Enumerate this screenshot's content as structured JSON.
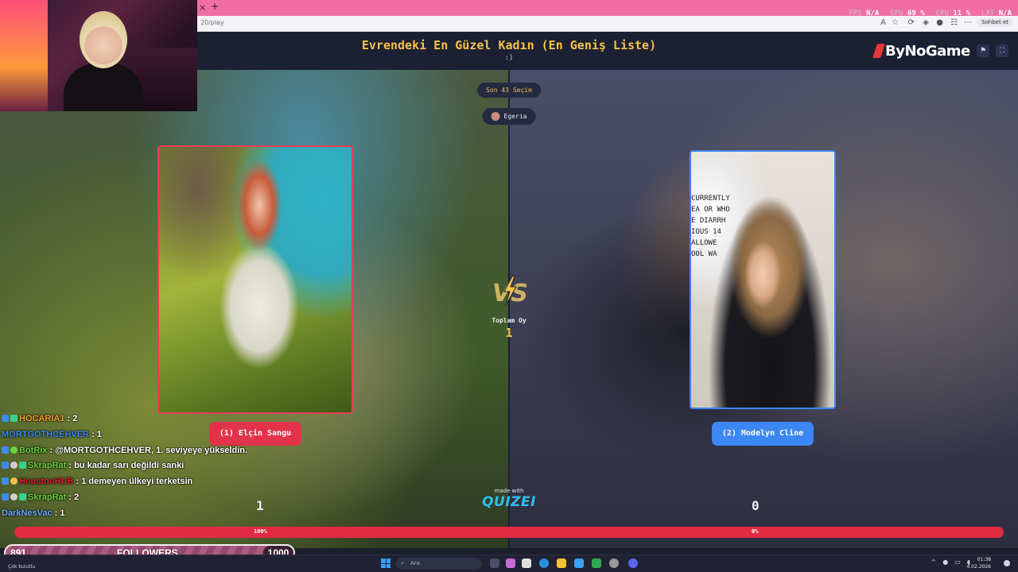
{
  "browser": {
    "url": "20/play",
    "chat_button": "Sohbet et"
  },
  "stats": {
    "fps_label": "FPS",
    "fps_value": "N/A",
    "gpu_label": "GPU",
    "gpu_value": "69 %",
    "cpu_label": "CPU",
    "cpu_value": "11 %",
    "lat_label": "LAT",
    "lat_value": "N/A"
  },
  "header": {
    "title": "Evrendeki En Güzel Kadın (En Geniş Liste)",
    "subtitle": ":)",
    "brand": "ByNoGame"
  },
  "game": {
    "recent_choices": "Son 43 Seçim",
    "user": "Egeria",
    "vs_label": "VS",
    "total_votes_label": "Toplam Oy",
    "total_votes": "1",
    "left": {
      "name": "(1) Elçin Sangu",
      "score": "1",
      "percent_label": "100%"
    },
    "right": {
      "name": "(2) Modelyn Cline",
      "score": "0",
      "percent_label": "0%"
    },
    "left_share": 1.0,
    "made_with": "made with",
    "made_with_brand": "QUIZEI",
    "photo_sign_text": "CURRENTLY\nEA OR WHO\nE DIARRH\nIOUS 14\nALLOWE\nOOL WA"
  },
  "chat": [
    {
      "user": "HOCARIA1",
      "text": ": 2",
      "color": "#f5a623"
    },
    {
      "user": "MORTGOTHCEHVER",
      "text": ": 1",
      "color": "#3b8cf0"
    },
    {
      "user": "BotRix",
      "text": ": @MORTGOTHCEHVER, 1. seviyeye yükseldin.",
      "color": "#6ad23c"
    },
    {
      "user": "SkrapRat",
      "text": ": bu kadar sarı değildi sanki",
      "color": "#6ad23c"
    },
    {
      "user": "HoustonHUB",
      "text": ": 1 demeyen ülkeyi terketsin",
      "color": "#e0202c"
    },
    {
      "user": "SkrapRat",
      "text": ": 2",
      "color": "#6ad23c"
    },
    {
      "user": "DarkNesVac",
      "text": ": 1",
      "color": "#6fa8ff"
    }
  ],
  "followers": {
    "current": "891",
    "label": "FOLLOWERS",
    "goal": "1000"
  },
  "taskbar": {
    "weather": "Çok bulutlu",
    "search": "Ara",
    "time": "01:38",
    "date": "4.02.2026"
  },
  "colors": {
    "accent_gold": "#f5c24a",
    "left_red": "#e2334b",
    "right_blue": "#3d86f5",
    "browser_pink": "#f06ea4"
  }
}
